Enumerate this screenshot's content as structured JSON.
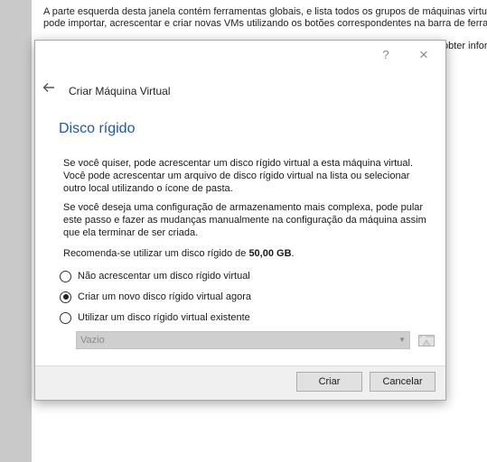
{
  "background": {
    "line1": "A parte esquerda desta janela contém ferramentas globais, e lista todos os grupos de máquinas virtua",
    "line2": "pode importar, acrescentar e criar novas VMs utilizando os botões correspondentes na barra de ferram",
    "line3": "obter infor"
  },
  "dialog": {
    "help_symbol": "?",
    "close_symbol": "×",
    "back_icon": "back-arrow-icon",
    "title": "Criar Máquina Virtual",
    "heading": "Disco rígido",
    "intro": "Se você quiser, pode acrescentar um disco rígido virtual a esta máquina virtual. Você pode acrescentar um arquivo de disco rígido virtual na lista ou selecionar outro local utilizando o ícone de pasta.",
    "advanced": "Se você deseja uma configuração de armazenamento mais complexa, pode pular este passo e fazer as mudanças manualmente na configuração da máquina assim que ela terminar de ser criada.",
    "recommend_prefix": "Recomenda-se utilizar um disco rígido de ",
    "recommend_size": "50,00 GB",
    "recommend_suffix": ".",
    "options": [
      {
        "label": "Não acrescentar um disco rígido virtual",
        "checked": false
      },
      {
        "label": "Criar um novo disco rígido virtual agora",
        "checked": true
      },
      {
        "label": "Utilizar um disco rígido virtual existente",
        "checked": false
      }
    ],
    "disk_select": {
      "value": "Vazio",
      "enabled": false
    },
    "folder_icon": "folder-icon",
    "create_label": "Criar",
    "cancel_label": "Cancelar"
  },
  "colors": {
    "heading": "#1e5aa8",
    "dialog_bg": "#f0f0f0",
    "content_bg": "#ffffff",
    "disabled_combo": "#cfcfcf"
  }
}
